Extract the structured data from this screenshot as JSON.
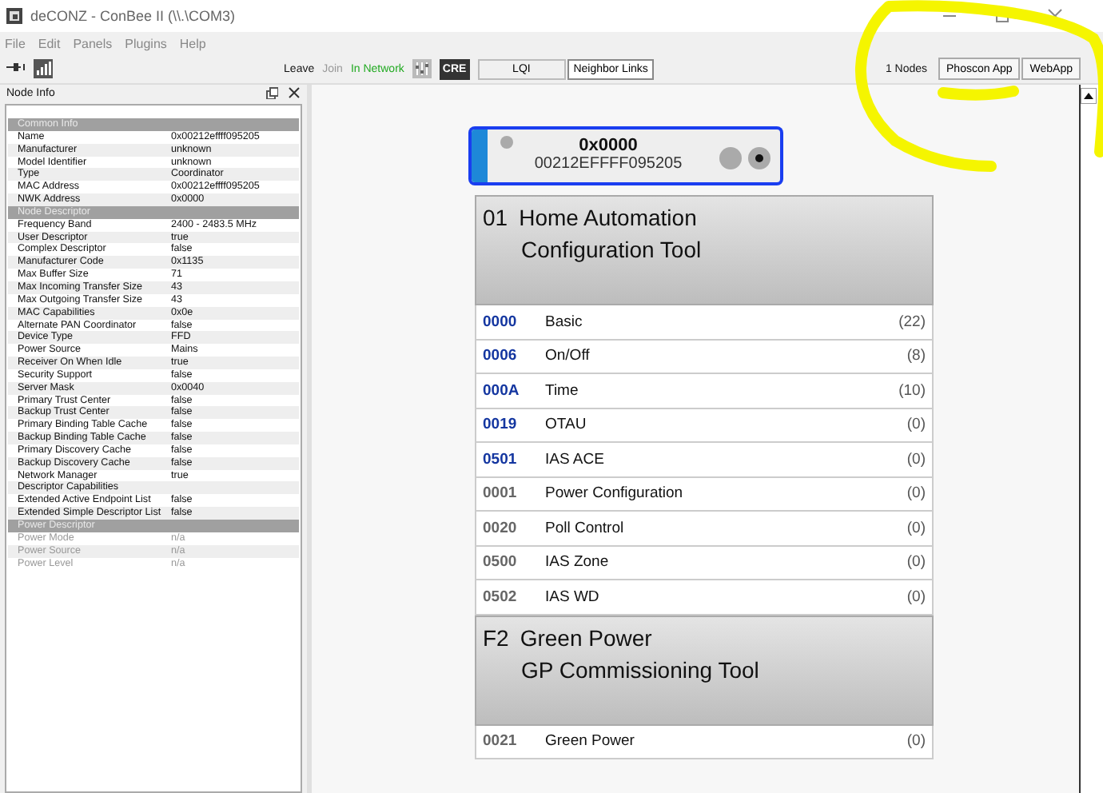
{
  "window": {
    "title": "deCONZ - ConBee II (\\\\.\\COM3)"
  },
  "menu": [
    "File",
    "Edit",
    "Panels",
    "Plugins",
    "Help"
  ],
  "toolbar": {
    "left_actions": [
      "Leave",
      "Join"
    ],
    "status": "In Network",
    "cre": "CRE",
    "view_tabs": [
      {
        "label": "LQI",
        "selected": false
      },
      {
        "label": "Neighbor Links",
        "selected": true
      }
    ],
    "node_count": "1 Nodes",
    "apps": [
      {
        "label": "Phoscon App"
      },
      {
        "label": "WebApp"
      }
    ]
  },
  "node_info": {
    "title": "Node Info",
    "rows": [
      {
        "kind": "section",
        "label": "Common Info"
      },
      {
        "kind": "property",
        "label": "Name",
        "value": "0x00212effff095205",
        "disabled": false
      },
      {
        "kind": "property",
        "label": "Manufacturer",
        "value": "unknown",
        "disabled": false
      },
      {
        "kind": "property",
        "label": "Model Identifier",
        "value": "unknown",
        "disabled": false
      },
      {
        "kind": "property",
        "label": "Type",
        "value": "Coordinator",
        "disabled": false
      },
      {
        "kind": "property",
        "label": "MAC Address",
        "value": "0x00212effff095205",
        "disabled": false
      },
      {
        "kind": "property",
        "label": "NWK Address",
        "value": "0x0000",
        "disabled": false
      },
      {
        "kind": "section",
        "label": "Node Descriptor"
      },
      {
        "kind": "property",
        "label": "Frequency Band",
        "value": "2400 - 2483.5 MHz",
        "disabled": false
      },
      {
        "kind": "property",
        "label": "User Descriptor",
        "value": "true",
        "disabled": false
      },
      {
        "kind": "property",
        "label": "Complex Descriptor",
        "value": "false",
        "disabled": false
      },
      {
        "kind": "property",
        "label": "Manufacturer Code",
        "value": "0x1135",
        "disabled": false
      },
      {
        "kind": "property",
        "label": "Max Buffer Size",
        "value": "71",
        "disabled": false
      },
      {
        "kind": "property",
        "label": "Max Incoming Transfer Size",
        "value": "43",
        "disabled": false
      },
      {
        "kind": "property",
        "label": "Max Outgoing Transfer Size",
        "value": "43",
        "disabled": false
      },
      {
        "kind": "property",
        "label": "MAC Capabilities",
        "value": "0x0e",
        "disabled": false
      },
      {
        "kind": "property",
        "label": "Alternate PAN Coordinator",
        "value": "false",
        "disabled": false
      },
      {
        "kind": "property",
        "label": "Device Type",
        "value": "FFD",
        "disabled": false
      },
      {
        "kind": "property",
        "label": "Power Source",
        "value": "Mains",
        "disabled": false
      },
      {
        "kind": "property",
        "label": "Receiver On When Idle",
        "value": "true",
        "disabled": false
      },
      {
        "kind": "property",
        "label": "Security Support",
        "value": "false",
        "disabled": false
      },
      {
        "kind": "property",
        "label": "Server Mask",
        "value": "0x0040",
        "disabled": false
      },
      {
        "kind": "property",
        "label": "Primary Trust Center",
        "value": "false",
        "disabled": false
      },
      {
        "kind": "property",
        "label": "Backup Trust Center",
        "value": "false",
        "disabled": false
      },
      {
        "kind": "property",
        "label": "Primary Binding Table Cache",
        "value": "false",
        "disabled": false
      },
      {
        "kind": "property",
        "label": "Backup Binding Table Cache",
        "value": "false",
        "disabled": false
      },
      {
        "kind": "property",
        "label": "Primary Discovery Cache",
        "value": "false",
        "disabled": false
      },
      {
        "kind": "property",
        "label": "Backup Discovery Cache",
        "value": "false",
        "disabled": false
      },
      {
        "kind": "property",
        "label": "Network Manager",
        "value": "true",
        "disabled": false
      },
      {
        "kind": "property",
        "label": "Descriptor Capabilities",
        "disabled": false
      },
      {
        "kind": "property",
        "label": "Extended Active Endpoint List",
        "value": "false",
        "disabled": false
      },
      {
        "kind": "property",
        "label": "Extended Simple Descriptor List",
        "value": "false",
        "disabled": false
      },
      {
        "kind": "section",
        "label": "Power Descriptor"
      },
      {
        "kind": "property",
        "label": "Power Mode",
        "value": "n/a",
        "disabled": true
      },
      {
        "kind": "property",
        "label": "Power Source",
        "value": "n/a",
        "disabled": true
      },
      {
        "kind": "property",
        "label": "Power Level",
        "value": "n/a",
        "disabled": true
      }
    ]
  },
  "node": {
    "address": "0x0000",
    "mac": "00212EFFFF095205",
    "selected": true
  },
  "endpoints": [
    {
      "number": "01",
      "profile": "Home Automation",
      "device": "Configuration Tool",
      "clusters": [
        {
          "id": "0000",
          "name": "Basic",
          "count": "(22)",
          "server": true
        },
        {
          "id": "0006",
          "name": "On/Off",
          "count": "(8)",
          "server": true
        },
        {
          "id": "000A",
          "name": "Time",
          "count": "(10)",
          "server": true
        },
        {
          "id": "0019",
          "name": "OTAU",
          "count": "(0)",
          "server": true
        },
        {
          "id": "0501",
          "name": "IAS ACE",
          "count": "(0)",
          "server": true
        },
        {
          "id": "0001",
          "name": "Power Configuration",
          "count": "(0)",
          "server": false
        },
        {
          "id": "0020",
          "name": "Poll Control",
          "count": "(0)",
          "server": false
        },
        {
          "id": "0500",
          "name": "IAS Zone",
          "count": "(0)",
          "server": false
        },
        {
          "id": "0502",
          "name": "IAS WD",
          "count": "(0)",
          "server": false
        }
      ]
    },
    {
      "number": "F2",
      "profile": "Green Power",
      "device": "GP Commissioning Tool",
      "clusters": [
        {
          "id": "0021",
          "name": "Green Power",
          "count": "(0)",
          "server": false
        }
      ]
    }
  ]
}
